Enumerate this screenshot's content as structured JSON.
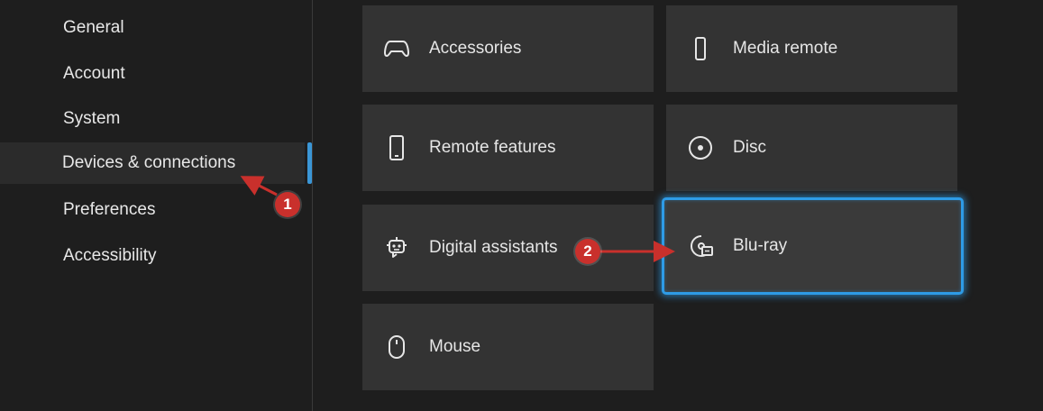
{
  "sidebar": {
    "items": [
      {
        "label": "General",
        "selected": false
      },
      {
        "label": "Account",
        "selected": false
      },
      {
        "label": "System",
        "selected": false
      },
      {
        "label": "Devices & connections",
        "selected": true
      },
      {
        "label": "Preferences",
        "selected": false
      },
      {
        "label": "Accessibility",
        "selected": false
      }
    ],
    "accent_color": "#3b96d6"
  },
  "tiles": [
    {
      "label": "Accessories",
      "icon": "gamepad-icon"
    },
    {
      "label": "Media remote",
      "icon": "remote-icon"
    },
    {
      "label": "Remote features",
      "icon": "phone-icon"
    },
    {
      "label": "Disc",
      "icon": "disc-icon"
    },
    {
      "label": "Digital assistants",
      "icon": "assistant-icon"
    },
    {
      "label": "Blu-ray",
      "icon": "bluray-icon",
      "focused": true
    },
    {
      "label": "Mouse",
      "icon": "mouse-icon"
    }
  ],
  "annotations": {
    "step1": "1",
    "step2": "2",
    "color": "#c9302c"
  }
}
